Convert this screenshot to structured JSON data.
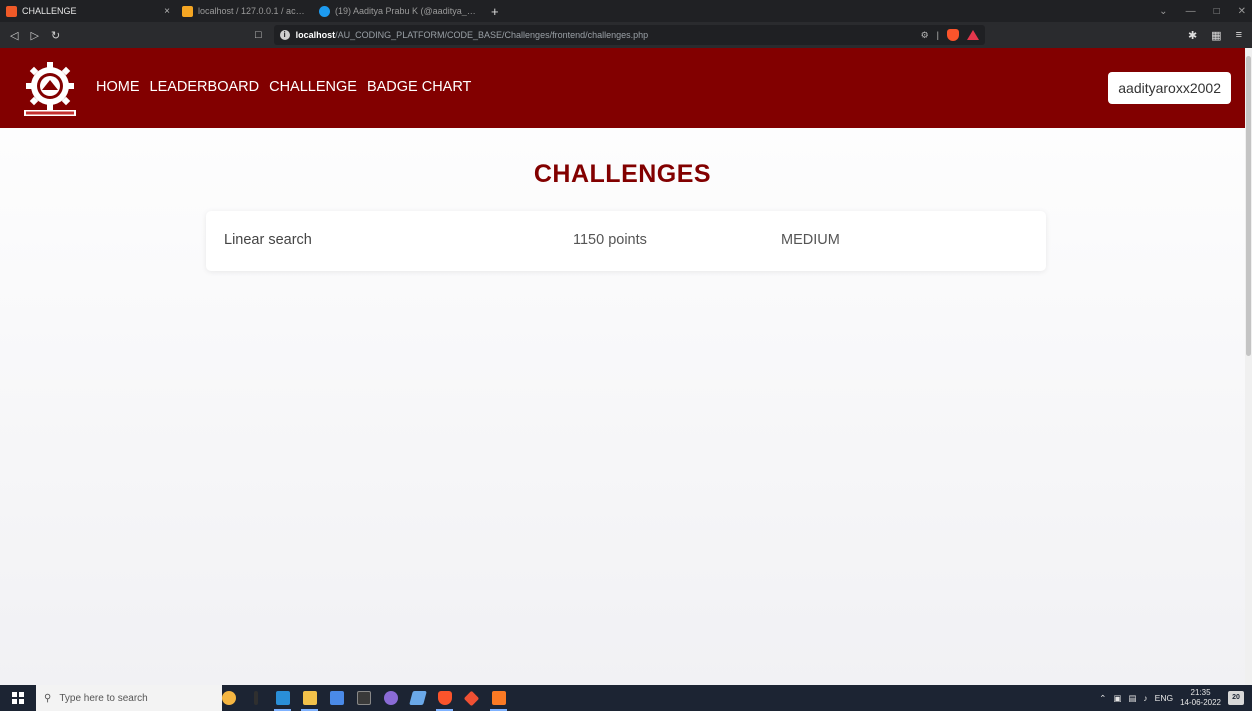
{
  "browser": {
    "tabs": [
      {
        "title": "CHALLENGE",
        "active": true,
        "favicon_color": "#f05a28"
      },
      {
        "title": "localhost / 127.0.0.1 / account databa",
        "active": false,
        "favicon_color": "#f5a623"
      },
      {
        "title": "(19) Aaditya Prabu K (@aaditya_2002)",
        "active": false,
        "favicon_color": "#1d9bf0"
      }
    ],
    "new_tab": "+",
    "close_glyph": "×",
    "url_host": "localhost",
    "url_path": "/AU_CODING_PLATFORM/CODE_BASE/Challenges/frontend/challenges.php"
  },
  "site": {
    "brand_color": "#820000",
    "nav": [
      {
        "label": "HOME"
      },
      {
        "label": "LEADERBOARD"
      },
      {
        "label": "CHALLENGE"
      },
      {
        "label": "BADGE CHART"
      }
    ],
    "username": "aadityaroxx2002"
  },
  "page": {
    "title": "CHALLENGES",
    "challenges": [
      {
        "name": "Linear search",
        "points": "1150 points",
        "difficulty": "MEDIUM"
      }
    ]
  },
  "taskbar": {
    "search_placeholder": "Type here to search",
    "language": "ENG",
    "time": "21:35",
    "date": "14-06-2022",
    "notification_count": "20"
  }
}
